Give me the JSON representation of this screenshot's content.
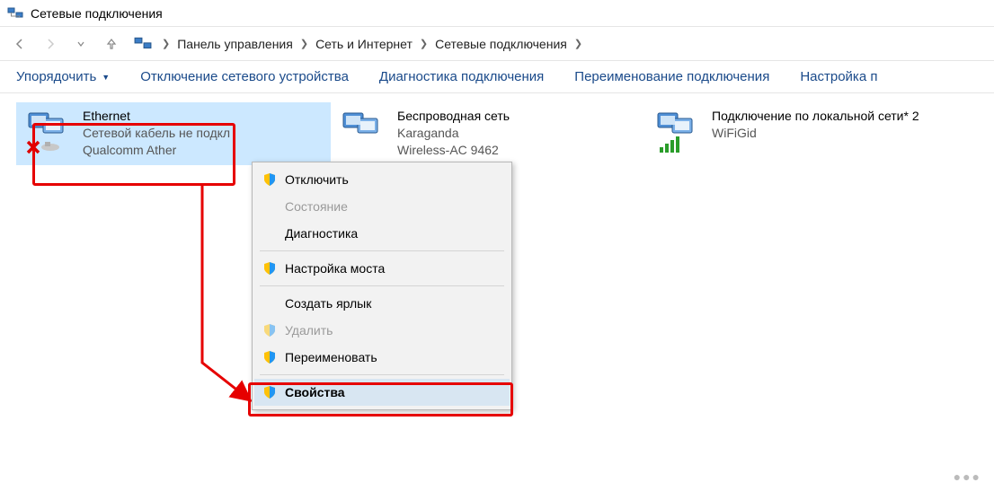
{
  "window_title": "Сетевые подключения",
  "breadcrumb": {
    "items": [
      "Панель управления",
      "Сеть и Интернет",
      "Сетевые подключения"
    ]
  },
  "toolbar": {
    "organize": "Упорядочить",
    "disable": "Отключение сетевого устройства",
    "diagnose": "Диагностика подключения",
    "rename": "Переименование подключения",
    "settings_partial": "Настройка п"
  },
  "connections": [
    {
      "title": "Ethernet",
      "status": "Сетевой кабель не подкл",
      "device": "Qualcomm Ather",
      "type": "ethernet",
      "disconnected": true
    },
    {
      "title": "Беспроводная сеть",
      "status": "Karaganda",
      "device": "Wireless-AC 9462",
      "type": "wired"
    },
    {
      "title": "Подключение по локальной сети* 2",
      "status": "",
      "device": "WiFiGid",
      "type": "wifi"
    }
  ],
  "context_menu": {
    "disable": "Отключить",
    "status": "Состояние",
    "diagnose": "Диагностика",
    "bridge": "Настройка моста",
    "shortcut": "Создать ярлык",
    "delete": "Удалить",
    "rename": "Переименовать",
    "properties": "Свойства"
  }
}
